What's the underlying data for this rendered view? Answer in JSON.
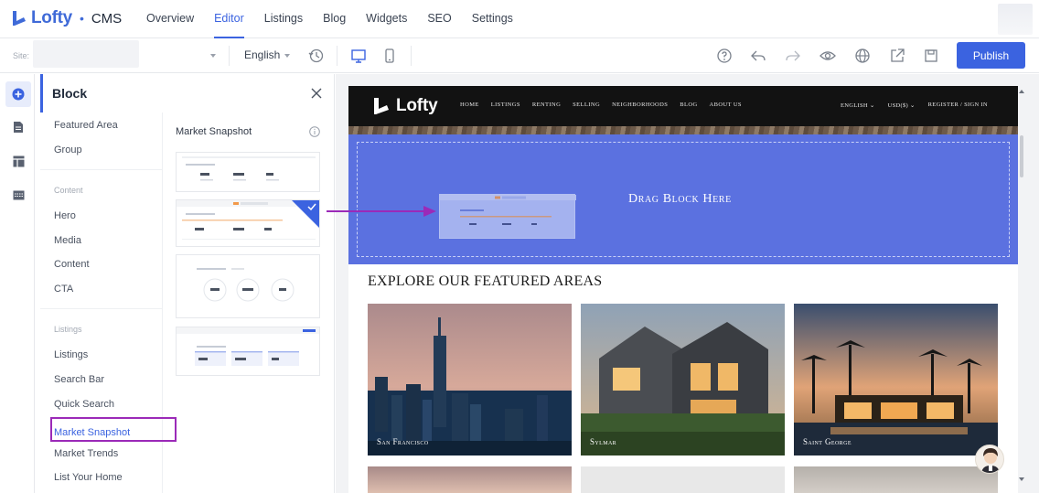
{
  "app": {
    "brand": "Lofty",
    "separator": "•",
    "product": "CMS"
  },
  "nav": {
    "items": [
      {
        "label": "Overview"
      },
      {
        "label": "Editor",
        "active": true
      },
      {
        "label": "Listings"
      },
      {
        "label": "Blog"
      },
      {
        "label": "Widgets"
      },
      {
        "label": "SEO"
      },
      {
        "label": "Settings"
      }
    ]
  },
  "toolbar": {
    "site_label": "Site:",
    "language": "English",
    "icons": [
      "history-icon",
      "desktop-icon",
      "mobile-icon",
      "help-icon",
      "undo-icon",
      "redo-icon",
      "preview-eye-icon",
      "globe-icon",
      "share-icon",
      "save-icon"
    ],
    "publish_label": "Publish"
  },
  "rail": {
    "icons": [
      "add-block-icon",
      "pages-icon",
      "layout-icon",
      "media-icon"
    ]
  },
  "block_panel": {
    "title": "Block",
    "groups": [
      {
        "items": [
          "Featured Area",
          "Group"
        ]
      },
      {
        "section": "Content",
        "items": [
          "Hero",
          "Media",
          "Content",
          "CTA"
        ]
      },
      {
        "section": "Listings",
        "items": [
          "Listings",
          "Search Bar",
          "Quick Search",
          "Market Snapshot",
          "Market Trends",
          "List Your Home"
        ]
      }
    ],
    "selected": "Market Snapshot",
    "preview_title": "Market Snapshot"
  },
  "site": {
    "brand": "Lofty",
    "links": [
      "HOME",
      "LISTINGS",
      "RENTING",
      "SELLING",
      "NEIGHBORHOODS",
      "BLOG",
      "ABOUT US"
    ],
    "right": [
      "ENGLISH",
      "USD($)",
      "REGISTER / SIGN IN"
    ],
    "dropzone_text": "Drag Block Here",
    "section_title": "EXPLORE OUR FEATURED AREAS",
    "areas": [
      {
        "name": "San Francisco"
      },
      {
        "name": "Sylmar"
      },
      {
        "name": "Saint George"
      }
    ]
  },
  "colors": {
    "accent": "#3b63e0",
    "dropzone": "#5b71e0",
    "highlight": "#9b2ab8"
  }
}
